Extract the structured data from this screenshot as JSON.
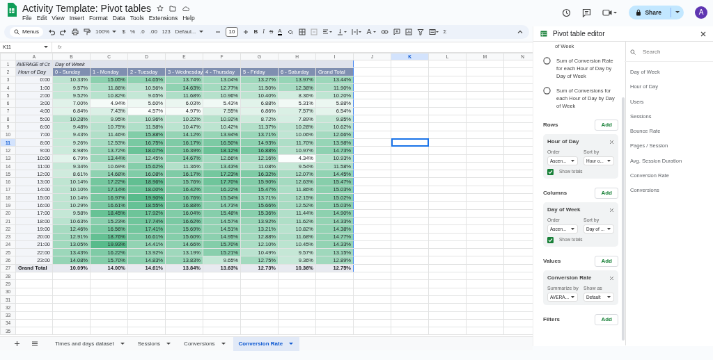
{
  "document": {
    "title": "Activity Template: Pivot tables",
    "menu": [
      "File",
      "Edit",
      "View",
      "Insert",
      "Format",
      "Data",
      "Tools",
      "Extensions",
      "Help"
    ]
  },
  "header_actions": {
    "share": "Share",
    "avatar": "A"
  },
  "toolbar": {
    "menus_search": "Menus",
    "zoom": "100%",
    "currency": "$",
    "percent": "%",
    "decrease_decimals": ".0",
    "increase_decimals": ".00",
    "number_format": "123",
    "font": "Defaul...",
    "font_size": "10",
    "bold": "B",
    "italic": "I",
    "strikethrough": "S",
    "text_color": "A",
    "functions": "Σ"
  },
  "formula_bar": {
    "cell": "K11",
    "fx": "fx"
  },
  "columns": [
    {
      "label": "A",
      "selected": false
    },
    {
      "label": "B",
      "selected": false
    },
    {
      "label": "C",
      "selected": false
    },
    {
      "label": "D",
      "selected": false
    },
    {
      "label": "E",
      "selected": false
    },
    {
      "label": "F",
      "selected": false
    },
    {
      "label": "G",
      "selected": false
    },
    {
      "label": "H",
      "selected": false
    },
    {
      "label": "I",
      "selected": false
    },
    {
      "label": "J",
      "selected": false
    },
    {
      "label": "K",
      "selected": true
    },
    {
      "label": "L",
      "selected": false
    },
    {
      "label": "M",
      "selected": false
    },
    {
      "label": "N",
      "selected": false
    }
  ],
  "rows": [
    {
      "label": "1",
      "selected": false
    },
    {
      "label": "2",
      "selected": false
    },
    {
      "label": "3",
      "selected": false
    },
    {
      "label": "4",
      "selected": false
    },
    {
      "label": "5",
      "selected": false
    },
    {
      "label": "6",
      "selected": false
    },
    {
      "label": "7",
      "selected": false
    },
    {
      "label": "8",
      "selected": false
    },
    {
      "label": "9",
      "selected": false
    },
    {
      "label": "10",
      "selected": false
    },
    {
      "label": "11",
      "selected": true
    },
    {
      "label": "12",
      "selected": false
    },
    {
      "label": "13",
      "selected": false
    },
    {
      "label": "14",
      "selected": false
    },
    {
      "label": "15",
      "selected": false
    },
    {
      "label": "16",
      "selected": false
    },
    {
      "label": "17",
      "selected": false
    },
    {
      "label": "18",
      "selected": false
    },
    {
      "label": "19",
      "selected": false
    },
    {
      "label": "20",
      "selected": false
    },
    {
      "label": "21",
      "selected": false
    },
    {
      "label": "22",
      "selected": false
    },
    {
      "label": "23",
      "selected": false
    },
    {
      "label": "24",
      "selected": false
    },
    {
      "label": "25",
      "selected": false
    },
    {
      "label": "26",
      "selected": false
    },
    {
      "label": "27",
      "selected": false
    },
    {
      "label": "28",
      "selected": false
    },
    {
      "label": "29",
      "selected": false
    },
    {
      "label": "30",
      "selected": false
    },
    {
      "label": "31",
      "selected": false
    },
    {
      "label": "32",
      "selected": false
    },
    {
      "label": "33",
      "selected": false
    },
    {
      "label": "34",
      "selected": false
    },
    {
      "label": "35",
      "selected": false
    }
  ],
  "pivot": {
    "corner": "AVERAGE of Cc",
    "column_field": "Day of Week",
    "row_field": "Hour of Day",
    "headers": [
      "0 - Sunday",
      "1 - Monday",
      "2 - Tuesday",
      "3 - Wednesday",
      "4 - Thursday",
      "5 - Friday",
      "6 - Saturday",
      "Grand Total"
    ],
    "rows": [
      {
        "hour": "0:00",
        "values": [
          "10.33%",
          "15.05%",
          "14.65%",
          "13.74%",
          "13.04%",
          "13.27%",
          "13.97%",
          "13.44%"
        ]
      },
      {
        "hour": "1:00",
        "values": [
          "9.57%",
          "11.86%",
          "10.56%",
          "14.63%",
          "12.77%",
          "11.50%",
          "12.38%",
          "11.90%"
        ]
      },
      {
        "hour": "2:00",
        "values": [
          "9.52%",
          "10.82%",
          "9.65%",
          "11.68%",
          "10.96%",
          "10.40%",
          "8.36%",
          "10.20%"
        ]
      },
      {
        "hour": "3:00",
        "values": [
          "7.00%",
          "4.94%",
          "5.60%",
          "6.03%",
          "5.43%",
          "6.88%",
          "5.31%",
          "5.88%"
        ]
      },
      {
        "hour": "4:00",
        "values": [
          "6.84%",
          "7.43%",
          "4.57%",
          "4.97%",
          "7.55%",
          "6.86%",
          "7.57%",
          "6.54%"
        ]
      },
      {
        "hour": "5:00",
        "values": [
          "10.28%",
          "9.95%",
          "10.96%",
          "10.22%",
          "10.92%",
          "8.72%",
          "7.89%",
          "9.85%"
        ]
      },
      {
        "hour": "6:00",
        "values": [
          "9.48%",
          "10.75%",
          "11.58%",
          "10.47%",
          "10.42%",
          "11.37%",
          "10.28%",
          "10.62%"
        ]
      },
      {
        "hour": "7:00",
        "values": [
          "9.43%",
          "11.46%",
          "15.88%",
          "14.12%",
          "13.94%",
          "13.71%",
          "10.06%",
          "12.66%"
        ]
      },
      {
        "hour": "8:00",
        "values": [
          "9.26%",
          "12.53%",
          "16.75%",
          "16.17%",
          "16.50%",
          "14.93%",
          "11.70%",
          "13.98%"
        ]
      },
      {
        "hour": "9:00",
        "values": [
          "8.98%",
          "13.72%",
          "18.07%",
          "16.39%",
          "18.12%",
          "16.88%",
          "10.97%",
          "14.73%"
        ]
      },
      {
        "hour": "10:00",
        "values": [
          "6.79%",
          "13.44%",
          "12.45%",
          "14.67%",
          "12.66%",
          "12.16%",
          "4.34%",
          "10.93%"
        ]
      },
      {
        "hour": "11:00",
        "values": [
          "9.34%",
          "10.69%",
          "15.62%",
          "11.36%",
          "13.43%",
          "11.08%",
          "9.54%",
          "11.58%"
        ]
      },
      {
        "hour": "12:00",
        "values": [
          "8.61%",
          "14.68%",
          "16.08%",
          "16.17%",
          "17.23%",
          "16.32%",
          "12.07%",
          "14.45%"
        ]
      },
      {
        "hour": "13:00",
        "values": [
          "10.14%",
          "17.22%",
          "18.96%",
          "15.76%",
          "17.70%",
          "15.90%",
          "12.63%",
          "15.47%"
        ]
      },
      {
        "hour": "14:00",
        "values": [
          "10.10%",
          "17.14%",
          "18.00%",
          "16.42%",
          "16.22%",
          "15.47%",
          "11.86%",
          "15.03%"
        ]
      },
      {
        "hour": "15:00",
        "values": [
          "10.14%",
          "16.97%",
          "19.90%",
          "16.76%",
          "15.54%",
          "13.71%",
          "12.15%",
          "15.02%"
        ]
      },
      {
        "hour": "16:00",
        "values": [
          "10.29%",
          "16.61%",
          "18.55%",
          "16.88%",
          "14.73%",
          "15.66%",
          "12.52%",
          "15.03%"
        ]
      },
      {
        "hour": "17:00",
        "values": [
          "9.58%",
          "18.45%",
          "17.92%",
          "16.04%",
          "15.48%",
          "15.36%",
          "11.44%",
          "14.90%"
        ]
      },
      {
        "hour": "18:00",
        "values": [
          "10.63%",
          "15.23%",
          "17.74%",
          "16.62%",
          "14.57%",
          "13.92%",
          "11.62%",
          "14.33%"
        ]
      },
      {
        "hour": "19:00",
        "values": [
          "12.46%",
          "16.56%",
          "17.41%",
          "15.69%",
          "14.51%",
          "13.21%",
          "10.82%",
          "14.38%"
        ]
      },
      {
        "hour": "20:00",
        "values": [
          "12.91%",
          "18.76%",
          "16.61%",
          "15.60%",
          "14.95%",
          "12.88%",
          "11.68%",
          "14.77%"
        ]
      },
      {
        "hour": "21:00",
        "values": [
          "13.05%",
          "19.93%",
          "14.41%",
          "14.66%",
          "15.70%",
          "12.10%",
          "10.45%",
          "14.33%"
        ]
      },
      {
        "hour": "22:00",
        "values": [
          "13.43%",
          "16.22%",
          "13.92%",
          "13.19%",
          "15.21%",
          "10.49%",
          "9.57%",
          "13.15%"
        ]
      },
      {
        "hour": "23:00",
        "values": [
          "14.08%",
          "15.70%",
          "14.83%",
          "13.83%",
          "9.65%",
          "12.75%",
          "9.36%",
          "12.89%"
        ]
      }
    ],
    "grand_total": {
      "label": "Grand Total",
      "values": [
        "10.09%",
        "14.00%",
        "14.61%",
        "13.84%",
        "13.63%",
        "12.73%",
        "10.36%",
        "12.75%"
      ]
    }
  },
  "sheet_tabs": [
    {
      "label": "Times and days dataset",
      "selected": false
    },
    {
      "label": "Sessions",
      "selected": false
    },
    {
      "label": "Conversions",
      "selected": false
    },
    {
      "label": "Conversion Rate",
      "selected": true
    }
  ],
  "editor": {
    "title": "Pivot table editor",
    "suggestion_tail": "of Week",
    "suggestions": [
      {
        "text": "Sum of Conversion Rate for each Hour of Day by Day of Week",
        "selected": false
      },
      {
        "text": "Sum of Conversions for each Hour of Day by Day of Week",
        "selected": false
      }
    ],
    "sections": [
      {
        "title": "Rows",
        "add": "Add",
        "card": {
          "title": "Hour of Day",
          "controls": [
            {
              "label": "Order",
              "value": "Ascen..."
            },
            {
              "label": "Sort by",
              "value": "Hour o..."
            }
          ],
          "show_totals": {
            "label": "Show totals",
            "checked": true
          }
        }
      },
      {
        "title": "Columns",
        "add": "Add",
        "card": {
          "title": "Day of Week",
          "controls": [
            {
              "label": "Order",
              "value": "Ascen..."
            },
            {
              "label": "Sort by",
              "value": "Day of ..."
            }
          ],
          "show_totals": {
            "label": "Show totals",
            "checked": true
          }
        }
      },
      {
        "title": "Values",
        "add": "Add",
        "card": {
          "title": "Conversion Rate",
          "controls": [
            {
              "label": "Summarize by",
              "value": "AVERA..."
            },
            {
              "label": "Show as",
              "value": "Default"
            }
          ]
        }
      },
      {
        "title": "Filters",
        "add": "Add"
      }
    ],
    "search_placeholder": "Search",
    "fields": [
      "Day of Week",
      "Hour of Day",
      "Users",
      "Sessions",
      "Bounce Rate",
      "Pages / Session",
      "Avg. Session Duration",
      "Conversion Rate",
      "Conversions"
    ]
  }
}
